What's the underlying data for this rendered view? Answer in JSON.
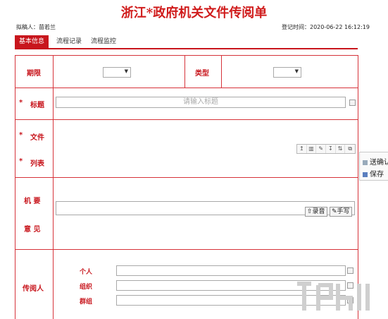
{
  "header": {
    "title": "浙江*政府机关文件传阅单",
    "drafter": "拟稿人：苗若兰",
    "register_time": "登记时间：2020-06-22 16:12:19"
  },
  "tabs": [
    {
      "label": "基本信息",
      "active": true
    },
    {
      "label": "流程记录",
      "active": false
    },
    {
      "label": "流程监控",
      "active": false
    }
  ],
  "form": {
    "period_label": "期限",
    "period_value": "",
    "type_label": "类型",
    "type_value": "",
    "required_mark": "*",
    "title_label": "标题",
    "title_placeholder": "请输入标题",
    "file_label_1": "文件",
    "file_label_2": "列表",
    "opinion_label_1": "机 要",
    "opinion_label_2": "意 见",
    "record_button": "录音",
    "handwrite_button": "手写",
    "readers_label": "传阅人",
    "person_label": "个人",
    "org_label": "组织",
    "group_label": "群组"
  },
  "side_panel": {
    "confirm_label": "送确认",
    "save_label": "保存"
  },
  "colors": {
    "brand_red": "#c8161d",
    "border_red": "#d6333a"
  }
}
